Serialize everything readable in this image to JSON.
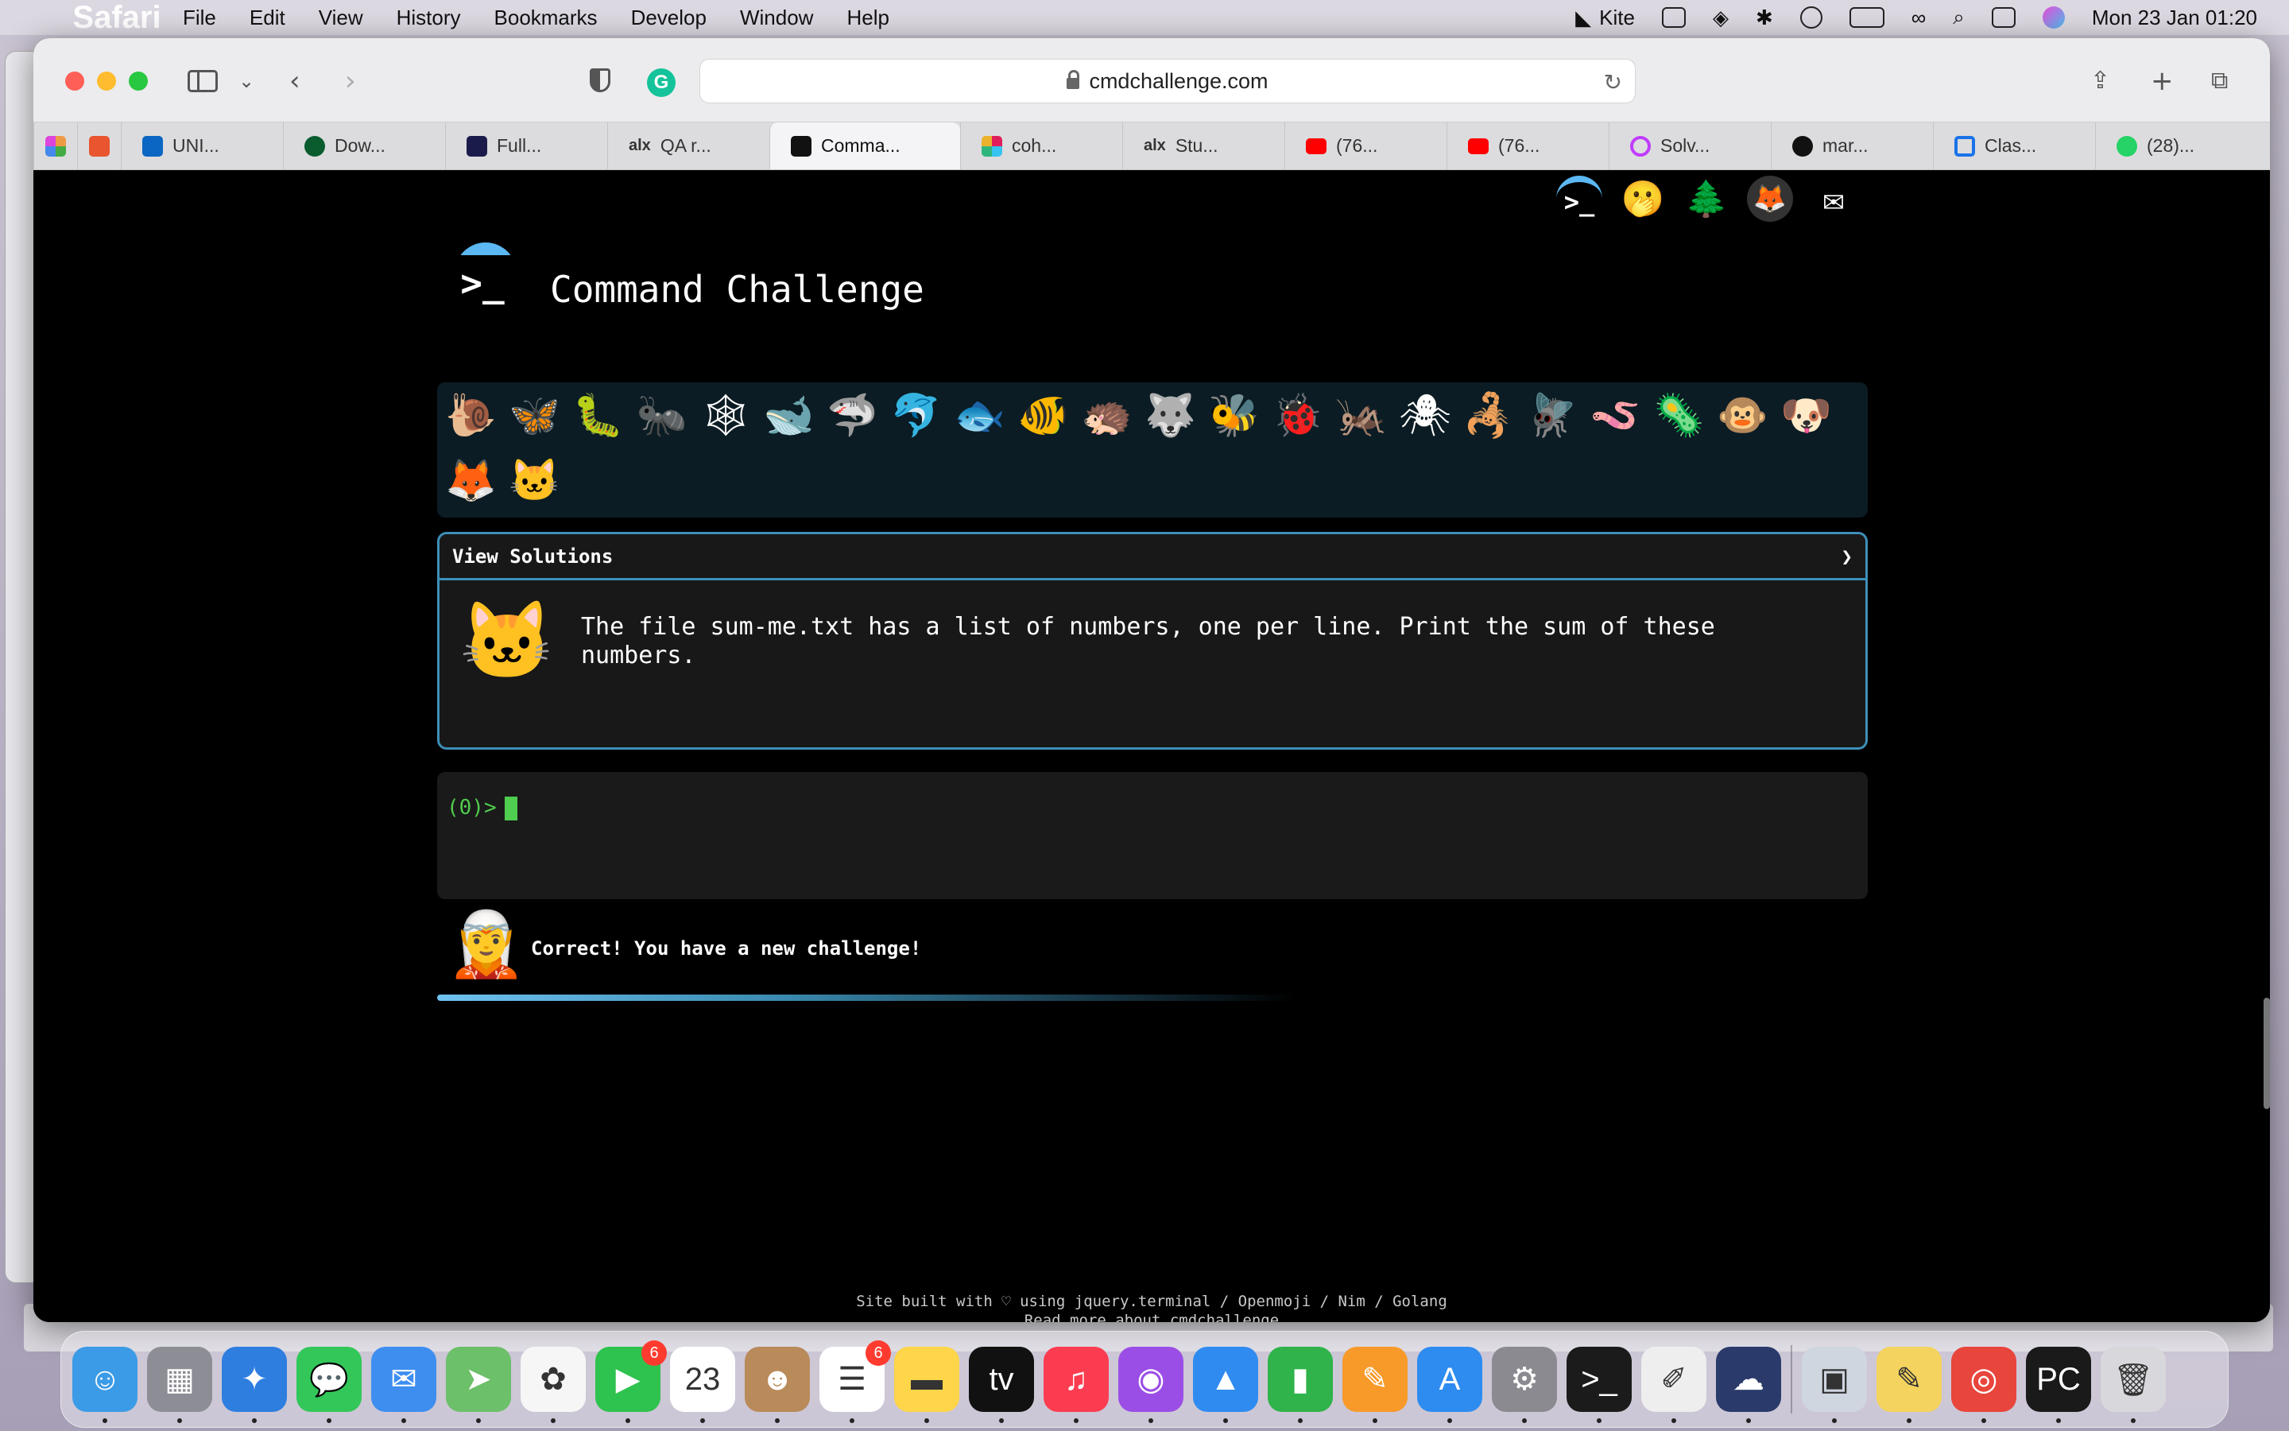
{
  "menubar": {
    "app": "Safari",
    "items": [
      "File",
      "Edit",
      "View",
      "History",
      "Bookmarks",
      "Develop",
      "Window",
      "Help"
    ],
    "kite_label": "Kite",
    "clock": "Mon 23 Jan  01:20"
  },
  "browser": {
    "url": "cmdchallenge.com",
    "tabs": [
      {
        "label": "UNI...",
        "color": "#0a66c2"
      },
      {
        "label": "Dow...",
        "color": "#0a5c2f"
      },
      {
        "label": "Full...",
        "color": "#1b1b4b"
      },
      {
        "label": "QA r...",
        "color": "#111111"
      },
      {
        "label": "Comma...",
        "color": "#111111"
      },
      {
        "label": "coh...",
        "color": "#e01e5a"
      },
      {
        "label": "Stu...",
        "color": "#111111"
      },
      {
        "label": "(76...",
        "color": "#ff0000"
      },
      {
        "label": "(76...",
        "color": "#ff0000"
      },
      {
        "label": "Solv...",
        "color": "#c13cff"
      },
      {
        "label": "mar...",
        "color": "#111111"
      },
      {
        "label": "Clas...",
        "color": "#1a73e8"
      },
      {
        "label": "(28)...",
        "color": "#25d366"
      }
    ]
  },
  "page": {
    "title": "Command Challenge",
    "logo_glyph": ">_",
    "top_icons": [
      "terminal-icon",
      "whisper-face-icon",
      "tree-icon",
      "gitlab-icon",
      "mail-icon"
    ],
    "badges": [
      "🐌",
      "🦋",
      "🐛",
      "🐜",
      "🕸",
      "🐋",
      "🦈",
      "🐬",
      "🐟",
      "🐠",
      "🦔",
      "🐺",
      "🐝",
      "🐞",
      "🦗",
      "🕷",
      "🦂",
      "🪰",
      "🪱",
      "🦠",
      "🐵",
      "🐶",
      "🦊",
      "🐱"
    ],
    "view_solutions": "View Solutions",
    "chevron": "❯",
    "challenge_text": "The file sum-me.txt has a list of numbers, one per line. Print the sum of these numbers.",
    "prompt": "(0)>",
    "message": "Correct! You have a new challenge!",
    "progress": 0.6,
    "footer_line1": "Site built with ♡ using jquery.terminal / Openmoji / Nim / Golang",
    "footer_line2": "Read more about cmdchallenge"
  },
  "dock": {
    "apps": [
      {
        "name": "Finder",
        "glyph": "☺",
        "color": "#3c9be6"
      },
      {
        "name": "Launchpad",
        "glyph": "▦",
        "color": "#8d8d96"
      },
      {
        "name": "Safari",
        "glyph": "✦",
        "color": "#2e7ee0"
      },
      {
        "name": "Messages",
        "glyph": "💬",
        "color": "#33c75a"
      },
      {
        "name": "Mail",
        "glyph": "✉",
        "color": "#3e8ef0"
      },
      {
        "name": "Maps",
        "glyph": "➤",
        "color": "#6cc06a"
      },
      {
        "name": "Photos",
        "glyph": "✿",
        "color": "#f6f6f6"
      },
      {
        "name": "FaceTime",
        "glyph": "▶",
        "color": "#2ec24e",
        "badge": "6"
      },
      {
        "name": "Calendar",
        "glyph": "23",
        "color": "#ffffff"
      },
      {
        "name": "Contacts",
        "glyph": "☻",
        "color": "#b98a5a"
      },
      {
        "name": "Reminders",
        "glyph": "☰",
        "color": "#ffffff",
        "badge": "6"
      },
      {
        "name": "Notes",
        "glyph": "▬",
        "color": "#ffd54a"
      },
      {
        "name": "TV",
        "glyph": "tv",
        "color": "#111111"
      },
      {
        "name": "Music",
        "glyph": "♫",
        "color": "#fb3c50"
      },
      {
        "name": "Podcasts",
        "glyph": "◉",
        "color": "#9b4ee6"
      },
      {
        "name": "Keynote",
        "glyph": "▲",
        "color": "#2f8bf0"
      },
      {
        "name": "Numbers",
        "glyph": "▮",
        "color": "#2fb34a"
      },
      {
        "name": "Pages",
        "glyph": "✎",
        "color": "#f79a2a"
      },
      {
        "name": "App Store",
        "glyph": "A",
        "color": "#2e8cf0"
      },
      {
        "name": "System Preferences",
        "glyph": "⚙",
        "color": "#8a8a90"
      },
      {
        "name": "Terminal",
        "glyph": ">_",
        "color": "#1b1b1b"
      },
      {
        "name": "Script Editor",
        "glyph": "✐",
        "color": "#eeeeee"
      },
      {
        "name": "Cloud App",
        "glyph": "☁",
        "color": "#2a3a6a"
      }
    ],
    "right_apps": [
      {
        "name": "Preview",
        "glyph": "▣",
        "color": "#cfd6e0"
      },
      {
        "name": "Stickies",
        "glyph": "✎",
        "color": "#f4d35e"
      },
      {
        "name": "Chrome",
        "glyph": "◎",
        "color": "#e8453c"
      },
      {
        "name": "PyCharm",
        "glyph": "PC",
        "color": "#1a1a1a"
      },
      {
        "name": "Trash",
        "glyph": "🗑",
        "color": "#d8d8dc"
      }
    ]
  }
}
